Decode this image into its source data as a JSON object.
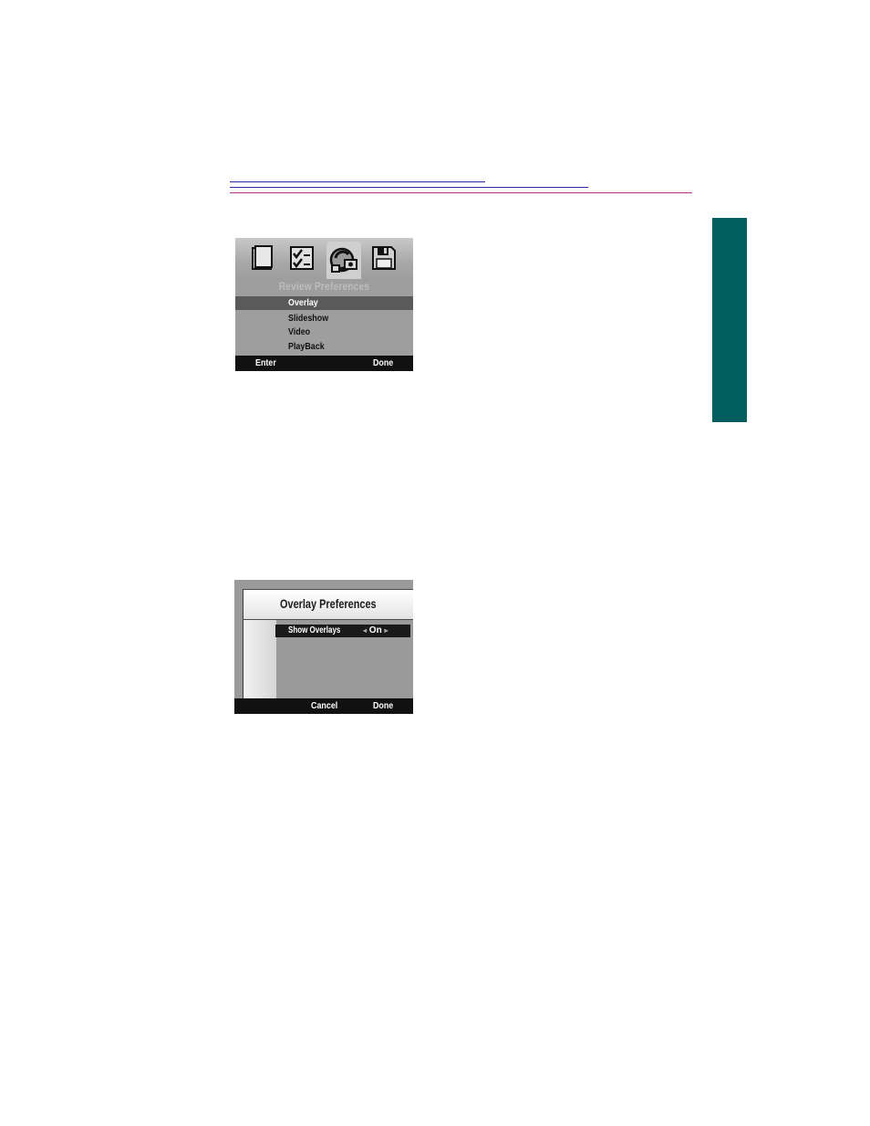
{
  "review_menu": {
    "icons": [
      "folder-icon",
      "checklist-icon",
      "preferences-icon",
      "disk-icon"
    ],
    "title": "Review Preferences",
    "items": [
      {
        "label": "Overlay",
        "selected": true
      },
      {
        "label": "Slideshow",
        "selected": false
      },
      {
        "label": "Video",
        "selected": false
      },
      {
        "label": "PlayBack",
        "selected": false
      }
    ],
    "footer": {
      "left": "Enter",
      "right": "Done"
    }
  },
  "overlay_screen": {
    "title": "Overlay Preferences",
    "setting": {
      "label": "Show Overlays",
      "value": "On"
    },
    "footer": {
      "middle": "Cancel",
      "right": "Done"
    }
  },
  "colors": {
    "section_tab": "#005e5e",
    "rule_blue": "#2a2aa8",
    "rule_magenta": "#b0308e"
  }
}
